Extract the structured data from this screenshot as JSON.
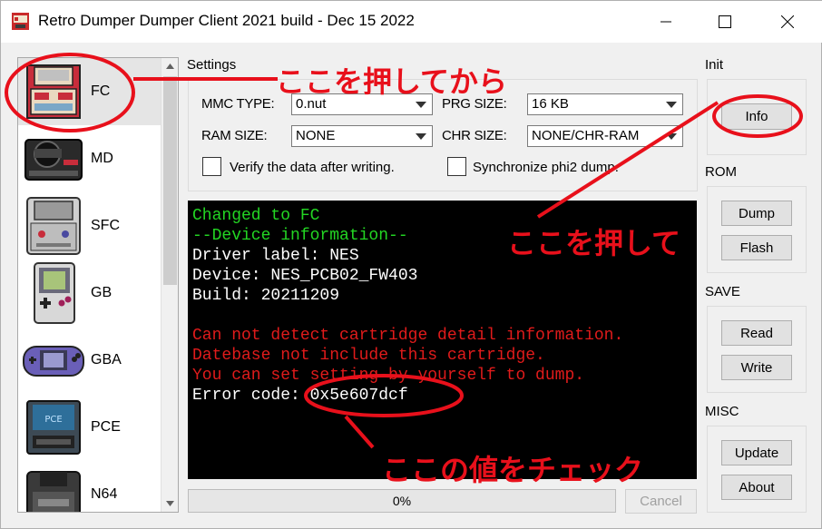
{
  "window": {
    "title": "Retro Dumper Dumper Client 2021 build - Dec 15 2022"
  },
  "consoles": [
    {
      "label": "FC",
      "selected": true,
      "icon": "famicom-icon"
    },
    {
      "label": "MD",
      "selected": false,
      "icon": "mega-drive-icon"
    },
    {
      "label": "SFC",
      "selected": false,
      "icon": "super-famicom-icon"
    },
    {
      "label": "GB",
      "selected": false,
      "icon": "game-boy-icon"
    },
    {
      "label": "GBA",
      "selected": false,
      "icon": "game-boy-advance-icon"
    },
    {
      "label": "PCE",
      "selected": false,
      "icon": "pc-engine-icon"
    },
    {
      "label": "N64",
      "selected": false,
      "icon": "nintendo-64-icon"
    }
  ],
  "settings": {
    "group_label": "Settings",
    "mmc_type_label": "MMC TYPE:",
    "mmc_type_value": "0.nut",
    "prg_size_label": "PRG SIZE:",
    "prg_size_value": "16 KB",
    "ram_size_label": "RAM SIZE:",
    "ram_size_value": "NONE",
    "chr_size_label": "CHR SIZE:",
    "chr_size_value": "NONE/CHR-RAM",
    "verify_label": "Verify the data after writing.",
    "verify_checked": false,
    "sync_label": "Synchronize phi2 dump.",
    "sync_checked": false
  },
  "log": [
    {
      "text": "Changed to FC",
      "color": "#23d623"
    },
    {
      "text": "--Device information--",
      "color": "#23d623"
    },
    {
      "text": "Driver label: NES",
      "color": "#ffffff"
    },
    {
      "text": "Device: NES_PCB02_FW403",
      "color": "#ffffff"
    },
    {
      "text": "Build: 20211209",
      "color": "#ffffff"
    },
    {
      "text": "",
      "color": "#ffffff"
    },
    {
      "text": "Can not detect cartridge detail information.",
      "color": "#e01b1b"
    },
    {
      "text": "Datebase not include this cartridge.",
      "color": "#e01b1b"
    },
    {
      "text": "You can set setting by yourself to dump.",
      "color": "#e01b1b"
    },
    {
      "text": "Error code: 0x5e607dcf",
      "color": "#ffffff"
    }
  ],
  "progress": {
    "percent": 0,
    "label": "0%"
  },
  "cancel_label": "Cancel",
  "sections": {
    "init": {
      "label": "Init",
      "info": "Info"
    },
    "rom": {
      "label": "ROM",
      "dump": "Dump",
      "flash": "Flash"
    },
    "save": {
      "label": "SAVE",
      "read": "Read",
      "write": "Write"
    },
    "misc": {
      "label": "MISC",
      "update": "Update",
      "about": "About"
    }
  },
  "annotations": {
    "press_first": "ここを押してから",
    "press_here": "ここを押して",
    "check_value": "ここの値をチェック",
    "color": "#e8101b"
  }
}
